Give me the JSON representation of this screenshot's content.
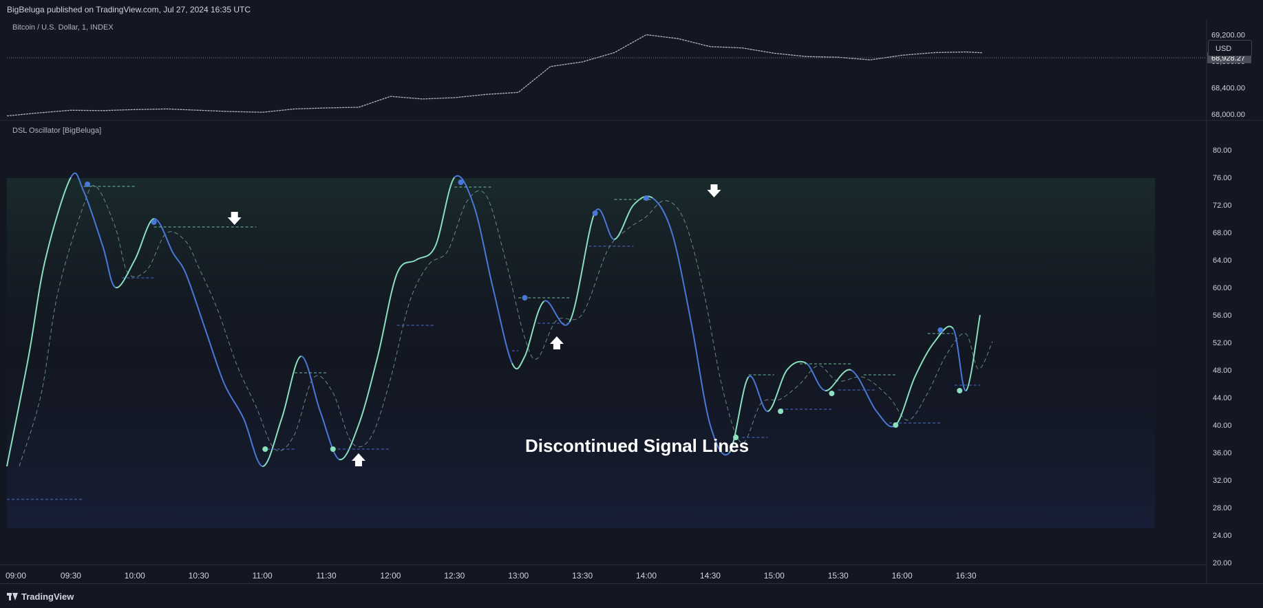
{
  "header": {
    "published": "BigBeluga published on TradingView.com, Jul 27, 2024 16:35 UTC"
  },
  "price_pane": {
    "symbol": "Bitcoin / U.S. Dollar, 1, INDEX",
    "currency_button": "USD",
    "last_price_label": "68,928.27"
  },
  "osc_pane": {
    "title": "DSL Oscillator [BigBeluga]"
  },
  "annotation": "Discontinued Signal Lines",
  "footer": {
    "brand": "TradingView"
  },
  "colors": {
    "background": "#131722",
    "osc_up": "#8be0c0",
    "osc_down": "#4a78d8",
    "upper_dsl": "#6fbf9c",
    "lower_dsl": "#4a6fd0",
    "price": "#b2b5be"
  },
  "chart_data": [
    {
      "type": "line",
      "name": "price",
      "y_ticks": [
        "68,000.00",
        "68,400.00",
        "68,800.00",
        "69,200.00"
      ],
      "ylim": [
        67980,
        69350
      ],
      "x": [
        0,
        0.25,
        0.5,
        0.75,
        1,
        1.25,
        1.5,
        1.75,
        2,
        2.25,
        2.5,
        2.75,
        3,
        3.25,
        3.5,
        3.75,
        4,
        4.25,
        4.5,
        4.75,
        5,
        5.25,
        5.5,
        5.75,
        6,
        6.25,
        6.5,
        6.75,
        7,
        7.25,
        7.5,
        7.625
      ],
      "values": [
        67975,
        68020,
        68060,
        68055,
        68070,
        68080,
        68060,
        68040,
        68030,
        68080,
        68095,
        68105,
        68270,
        68230,
        68250,
        68300,
        68330,
        68720,
        68790,
        68930,
        69200,
        69140,
        69020,
        69000,
        68920,
        68870,
        68860,
        68820,
        68890,
        68930,
        68940,
        68928
      ]
    },
    {
      "type": "line",
      "name": "oscillator",
      "x_ticks": [
        "09:00",
        "09:30",
        "10:00",
        "10:30",
        "11:00",
        "11:30",
        "12:00",
        "12:30",
        "13:00",
        "13:30",
        "14:00",
        "14:30",
        "15:00",
        "15:30",
        "16:00",
        "16:30"
      ],
      "y_ticks": [
        "20.00",
        "24.00",
        "28.00",
        "32.00",
        "36.00",
        "40.00",
        "44.00",
        "48.00",
        "52.00",
        "56.00",
        "60.00",
        "64.00",
        "68.00",
        "72.00",
        "76.00",
        "80.00"
      ],
      "ylim": [
        20,
        81
      ],
      "zone": [
        25,
        75
      ],
      "x": [
        0,
        0.17,
        0.3,
        0.5,
        0.6,
        0.75,
        0.85,
        1,
        1.15,
        1.3,
        1.4,
        1.55,
        1.7,
        1.85,
        2,
        2.15,
        2.3,
        2.45,
        2.6,
        2.75,
        2.9,
        3.05,
        3.2,
        3.35,
        3.5,
        3.65,
        3.8,
        3.95,
        4.05,
        4.2,
        4.4,
        4.6,
        4.75,
        4.9,
        5.05,
        5.2,
        5.35,
        5.5,
        5.65,
        5.8,
        5.95,
        6.1,
        6.25,
        6.4,
        6.6,
        6.8,
        6.95,
        7.1,
        7.25,
        7.4,
        7.5,
        7.61
      ],
      "values": [
        34,
        50,
        64,
        76,
        74,
        66,
        60,
        64,
        70,
        65,
        62,
        54,
        46,
        41,
        34,
        41,
        50,
        42,
        35,
        40,
        50,
        62,
        64,
        66,
        76,
        72,
        60,
        49,
        50,
        58,
        55,
        71,
        67,
        72,
        73,
        68,
        55,
        40,
        36,
        47,
        42,
        48,
        49,
        45,
        48,
        42,
        40,
        47,
        52,
        54,
        45,
        56
      ],
      "upper_dsl_levels": [
        74.7,
        68.8,
        47.6,
        74.6,
        58.5,
        72.8,
        47.3,
        48.9,
        47.3,
        53.3
      ],
      "lower_dsl_levels": [
        29.2,
        61.4,
        36.5,
        36.5,
        54.8,
        50.8,
        54.5,
        66.0,
        38.2,
        42.3,
        45.1,
        40.3,
        45.8
      ],
      "signals": [
        "down",
        "up",
        "up",
        "down"
      ]
    }
  ]
}
